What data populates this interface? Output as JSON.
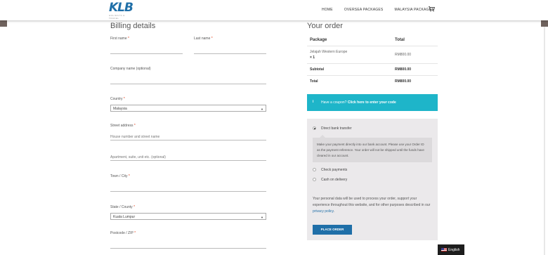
{
  "header": {
    "logo": "KLB",
    "logo_sub": "HOLIDAYS & TRAVEL",
    "nav": [
      "HOME",
      "OVERSEA PACKAGES",
      "MALAYSIA PACKAGES"
    ]
  },
  "billing": {
    "title": "Billing details",
    "first_name": "First name",
    "last_name": "Last name",
    "company": "Company name (optional)",
    "country": "Country",
    "country_value": "Malaysia",
    "street": "Street address",
    "street_ph": "House number and street name",
    "apartment_ph": "Apartment, suite, unit etc. (optional)",
    "town": "Town / City",
    "state": "State / County",
    "state_value": "Kuala Lumpur",
    "postcode": "Postcode / ZIP",
    "required_mark": "*"
  },
  "order": {
    "title": "Your order",
    "col_package": "Package",
    "col_total": "Total",
    "item_name": "Jelajah Western Europe",
    "item_qty": "× 1",
    "item_price": "RM800.00",
    "subtotal_label": "Subtotal",
    "subtotal_value": "RM800.00",
    "total_label": "Total",
    "total_value": "RM800.00"
  },
  "coupon": {
    "icon": "i",
    "text": "Have a coupon?",
    "link": "Click here to enter your code"
  },
  "payment": {
    "bank": "Direct bank transfer",
    "bank_desc": "Make your payment directly into our bank account. Please use your Order ID as the payment reference. Your order will not be shipped until the funds have cleared in our account.",
    "check": "Check payments",
    "cod": "Cash on delivery",
    "privacy_text": "Your personal data will be used to process your order, support your experience throughout this website, and for other purposes described in our",
    "privacy_link": "privacy policy",
    "place_order": "Place order"
  },
  "language": "English",
  "colors": {
    "brand": "#1f6fa8",
    "coupon_bg": "#1eb5c9",
    "required": "#e2401c"
  }
}
